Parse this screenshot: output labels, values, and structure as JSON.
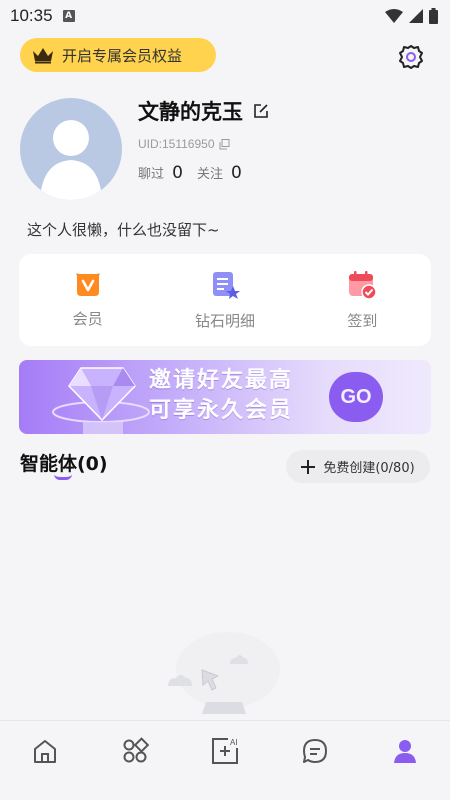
{
  "status_bar": {
    "time": "10:35",
    "a_badge": "A"
  },
  "header": {
    "vip_label": "开启专属会员权益"
  },
  "profile": {
    "username": "文静的克玉",
    "uid": "UID:15116950",
    "chat_label": "聊过",
    "chat_count": "0",
    "follow_label": "关注",
    "follow_count": "0",
    "bio": "这个人很懒，什么也没留下~"
  },
  "quick_actions": [
    {
      "label": "会员",
      "icon": "vip-icon",
      "color": "#ff8a1f"
    },
    {
      "label": "钻石明细",
      "icon": "diamond-detail-icon",
      "color": "#6c6cf0"
    },
    {
      "label": "签到",
      "icon": "checkin-calendar-icon",
      "color": "#f04a5a"
    }
  ],
  "banner": {
    "line1": "邀请好友最高",
    "line2": "可享永久会员",
    "go_label": "GO"
  },
  "agents": {
    "title": "智能体(0)",
    "create_label": "免费创建(0/80)"
  },
  "colors": {
    "accent": "#8b5cf0",
    "vip_yellow": "#ffd34d",
    "background": "#f5f5f7"
  },
  "tabs": [
    {
      "icon": "home-icon",
      "active": false
    },
    {
      "icon": "apps-grid-icon",
      "active": false
    },
    {
      "icon": "ai-create-icon",
      "active": false,
      "badge": "AI"
    },
    {
      "icon": "messages-icon",
      "active": false
    },
    {
      "icon": "profile-icon",
      "active": true
    }
  ]
}
